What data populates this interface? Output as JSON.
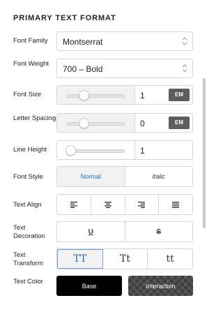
{
  "panel": {
    "title": "PRIMARY TEXT FORMAT"
  },
  "font_family": {
    "label": "Font Family",
    "value": "Montserrat"
  },
  "font_weight": {
    "label": "Font Weight",
    "value": "700 – Bold"
  },
  "font_size": {
    "label": "Font Size",
    "value": "1",
    "unit": "EM",
    "slider_level": 0.12
  },
  "letter_spacing": {
    "label": "Letter Spacing",
    "value": "0",
    "unit": "EM",
    "slider_level": 0.12
  },
  "line_height": {
    "label": "Line Height",
    "value": "1",
    "slider_level": 0.02
  },
  "font_style": {
    "label": "Font Style",
    "options": [
      "Normal",
      "Italic"
    ],
    "selected": "Normal"
  },
  "text_align": {
    "label": "Text Align",
    "options": [
      "left",
      "center",
      "right",
      "justify"
    ]
  },
  "text_decoration": {
    "label": "Text Decoration",
    "underline": "U",
    "strike": "S"
  },
  "text_transform": {
    "label": "Text Transform",
    "options": [
      "TT",
      "Tt",
      "tt"
    ],
    "selected": "TT"
  },
  "text_color": {
    "label": "Text Color",
    "base": "Base",
    "interaction": "Interaction",
    "base_color": "#000000"
  },
  "accent_color": "#2e6db4"
}
